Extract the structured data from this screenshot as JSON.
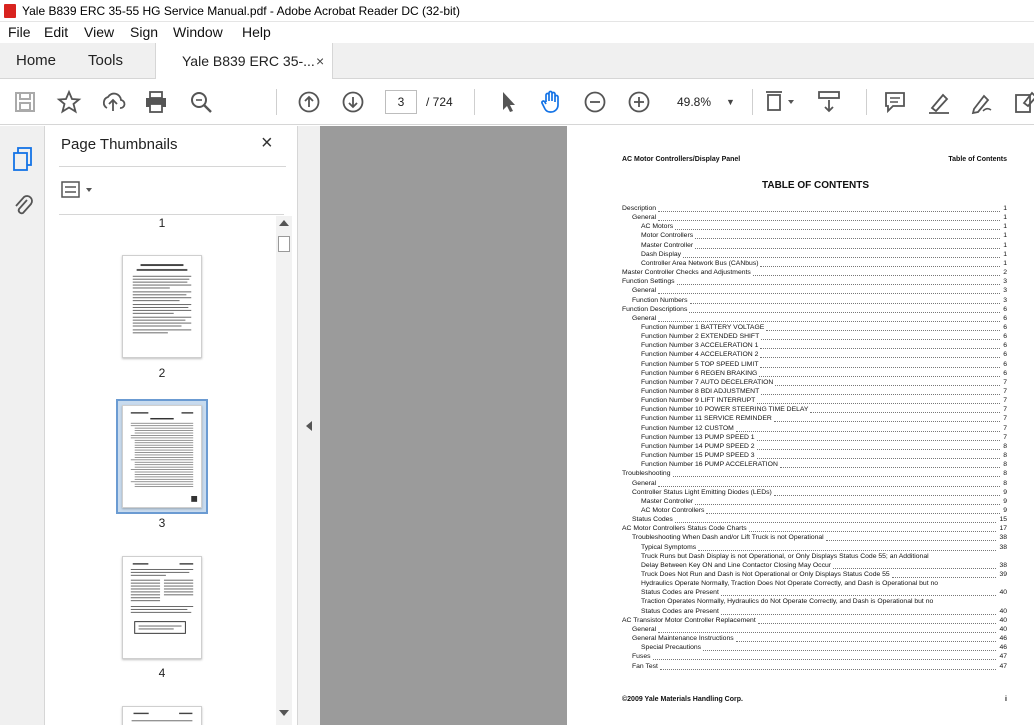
{
  "window": {
    "title": "Yale B839 ERC 35-55 HG Service Manual.pdf - Adobe Acrobat Reader DC (32-bit)"
  },
  "menu": [
    "File",
    "Edit",
    "View",
    "Sign",
    "Window",
    "Help"
  ],
  "tabs": {
    "home": "Home",
    "tools": "Tools",
    "document": "Yale B839 ERC 35-...",
    "close": "×"
  },
  "toolbar": {
    "page_current": "3",
    "page_total": "/ 724",
    "zoom": "49.8%",
    "icons": [
      "save-icon",
      "bookmark-star-icon",
      "share-upload-icon",
      "print-icon",
      "find-zoom-icon",
      "page-up-icon",
      "page-down-icon",
      "select-cursor-icon",
      "hand-tool-icon",
      "zoom-out-icon",
      "zoom-in-icon",
      "fit-page-icon",
      "scroll-mode-icon",
      "comment-icon",
      "highlight-icon",
      "sign-icon",
      "more-tools-icon"
    ]
  },
  "panel": {
    "title": "Page Thumbnails",
    "close": "×",
    "thumb_labels": [
      "1",
      "2",
      "3",
      "4"
    ],
    "selected": "3"
  },
  "document": {
    "header_left": "AC Motor Controllers/Display Panel",
    "header_right": "Table of Contents",
    "toc_title": "TABLE OF CONTENTS",
    "footer_left": "©2009 Yale Materials Handling Corp.",
    "footer_right": "i",
    "toc": [
      {
        "t": "Description",
        "p": "1",
        "l": 0
      },
      {
        "t": "General",
        "p": "1",
        "l": 1
      },
      {
        "t": "AC Motors",
        "p": "1",
        "l": 2
      },
      {
        "t": "Motor Controllers",
        "p": "1",
        "l": 2
      },
      {
        "t": "Master Controller",
        "p": "1",
        "l": 2
      },
      {
        "t": "Dash Display",
        "p": "1",
        "l": 2
      },
      {
        "t": "Controller Area Network Bus (CANbus)",
        "p": "1",
        "l": 2
      },
      {
        "t": "Master Controller Checks and Adjustments",
        "p": "2",
        "l": 0
      },
      {
        "t": "Function Settings",
        "p": "3",
        "l": 0
      },
      {
        "t": "General",
        "p": "3",
        "l": 1
      },
      {
        "t": "Function Numbers",
        "p": "3",
        "l": 1
      },
      {
        "t": "Function Descriptions",
        "p": "6",
        "l": 0
      },
      {
        "t": "General",
        "p": "6",
        "l": 1
      },
      {
        "t": "Function Number 1 BATTERY VOLTAGE",
        "p": "6",
        "l": 2
      },
      {
        "t": "Function Number 2 EXTENDED SHIFT",
        "p": "6",
        "l": 2
      },
      {
        "t": "Function Number 3 ACCELERATION 1",
        "p": "6",
        "l": 2
      },
      {
        "t": "Function Number 4 ACCELERATION 2",
        "p": "6",
        "l": 2
      },
      {
        "t": "Function Number 5 TOP SPEED LIMIT",
        "p": "6",
        "l": 2
      },
      {
        "t": "Function Number 6 REGEN BRAKING",
        "p": "6",
        "l": 2
      },
      {
        "t": "Function Number 7 AUTO DECELERATION",
        "p": "7",
        "l": 2
      },
      {
        "t": "Function Number 8 BDI ADJUSTMENT",
        "p": "7",
        "l": 2
      },
      {
        "t": "Function Number 9 LIFT INTERRUPT",
        "p": "7",
        "l": 2
      },
      {
        "t": "Function Number 10 POWER STEERING TIME DELAY",
        "p": "7",
        "l": 2
      },
      {
        "t": "Function Number 11 SERVICE REMINDER",
        "p": "7",
        "l": 2
      },
      {
        "t": "Function Number 12 CUSTOM",
        "p": "7",
        "l": 2
      },
      {
        "t": "Function Number 13 PUMP SPEED 1",
        "p": "7",
        "l": 2
      },
      {
        "t": "Function Number 14 PUMP SPEED 2",
        "p": "8",
        "l": 2
      },
      {
        "t": "Function Number 15 PUMP SPEED 3",
        "p": "8",
        "l": 2
      },
      {
        "t": "Function Number 16 PUMP ACCELERATION",
        "p": "8",
        "l": 2
      },
      {
        "t": "Troubleshooting",
        "p": "8",
        "l": 0
      },
      {
        "t": "General",
        "p": "8",
        "l": 1
      },
      {
        "t": "Controller Status Light Emitting Diodes (LEDs)",
        "p": "9",
        "l": 1
      },
      {
        "t": "Master Controller",
        "p": "9",
        "l": 2
      },
      {
        "t": "AC Motor Controllers",
        "p": "9",
        "l": 2
      },
      {
        "t": "Status Codes",
        "p": "15",
        "l": 1
      },
      {
        "t": "AC Motor Controllers Status Code Charts",
        "p": "17",
        "l": 0
      },
      {
        "t": "Troubleshooting When Dash and/or Lift Truck is not Operational",
        "p": "38",
        "l": 1
      },
      {
        "t": "Typical Symptoms",
        "p": "38",
        "l": 2
      },
      {
        "t": "Truck Runs but Dash Display is not Operational, or Only Displays Status Code 55; an Additional",
        "p": "",
        "l": 2
      },
      {
        "t": "Delay Between Key ON and Line Contactor Closing May Occur",
        "p": "38",
        "l": 2
      },
      {
        "t": "Truck Does Not Run and Dash is Not Operational or Only Displays Status Code 55",
        "p": "39",
        "l": 2
      },
      {
        "t": "Hydraulics Operate Normally, Traction Does Not Operate Correctly, and Dash is Operational but no",
        "p": "",
        "l": 2
      },
      {
        "t": "Status Codes are Present",
        "p": "40",
        "l": 2
      },
      {
        "t": "Traction Operates Normally, Hydraulics do Not Operate Correctly, and Dash is Operational but no",
        "p": "",
        "l": 2
      },
      {
        "t": "Status Codes are Present",
        "p": "40",
        "l": 2
      },
      {
        "t": "AC Transistor Motor Controller Replacement",
        "p": "40",
        "l": 0
      },
      {
        "t": "General",
        "p": "40",
        "l": 1
      },
      {
        "t": "General Maintenance Instructions",
        "p": "46",
        "l": 1
      },
      {
        "t": "Special Precautions",
        "p": "46",
        "l": 2
      },
      {
        "t": "Fuses",
        "p": "47",
        "l": 1
      },
      {
        "t": "Fan Test",
        "p": "47",
        "l": 1
      }
    ]
  }
}
